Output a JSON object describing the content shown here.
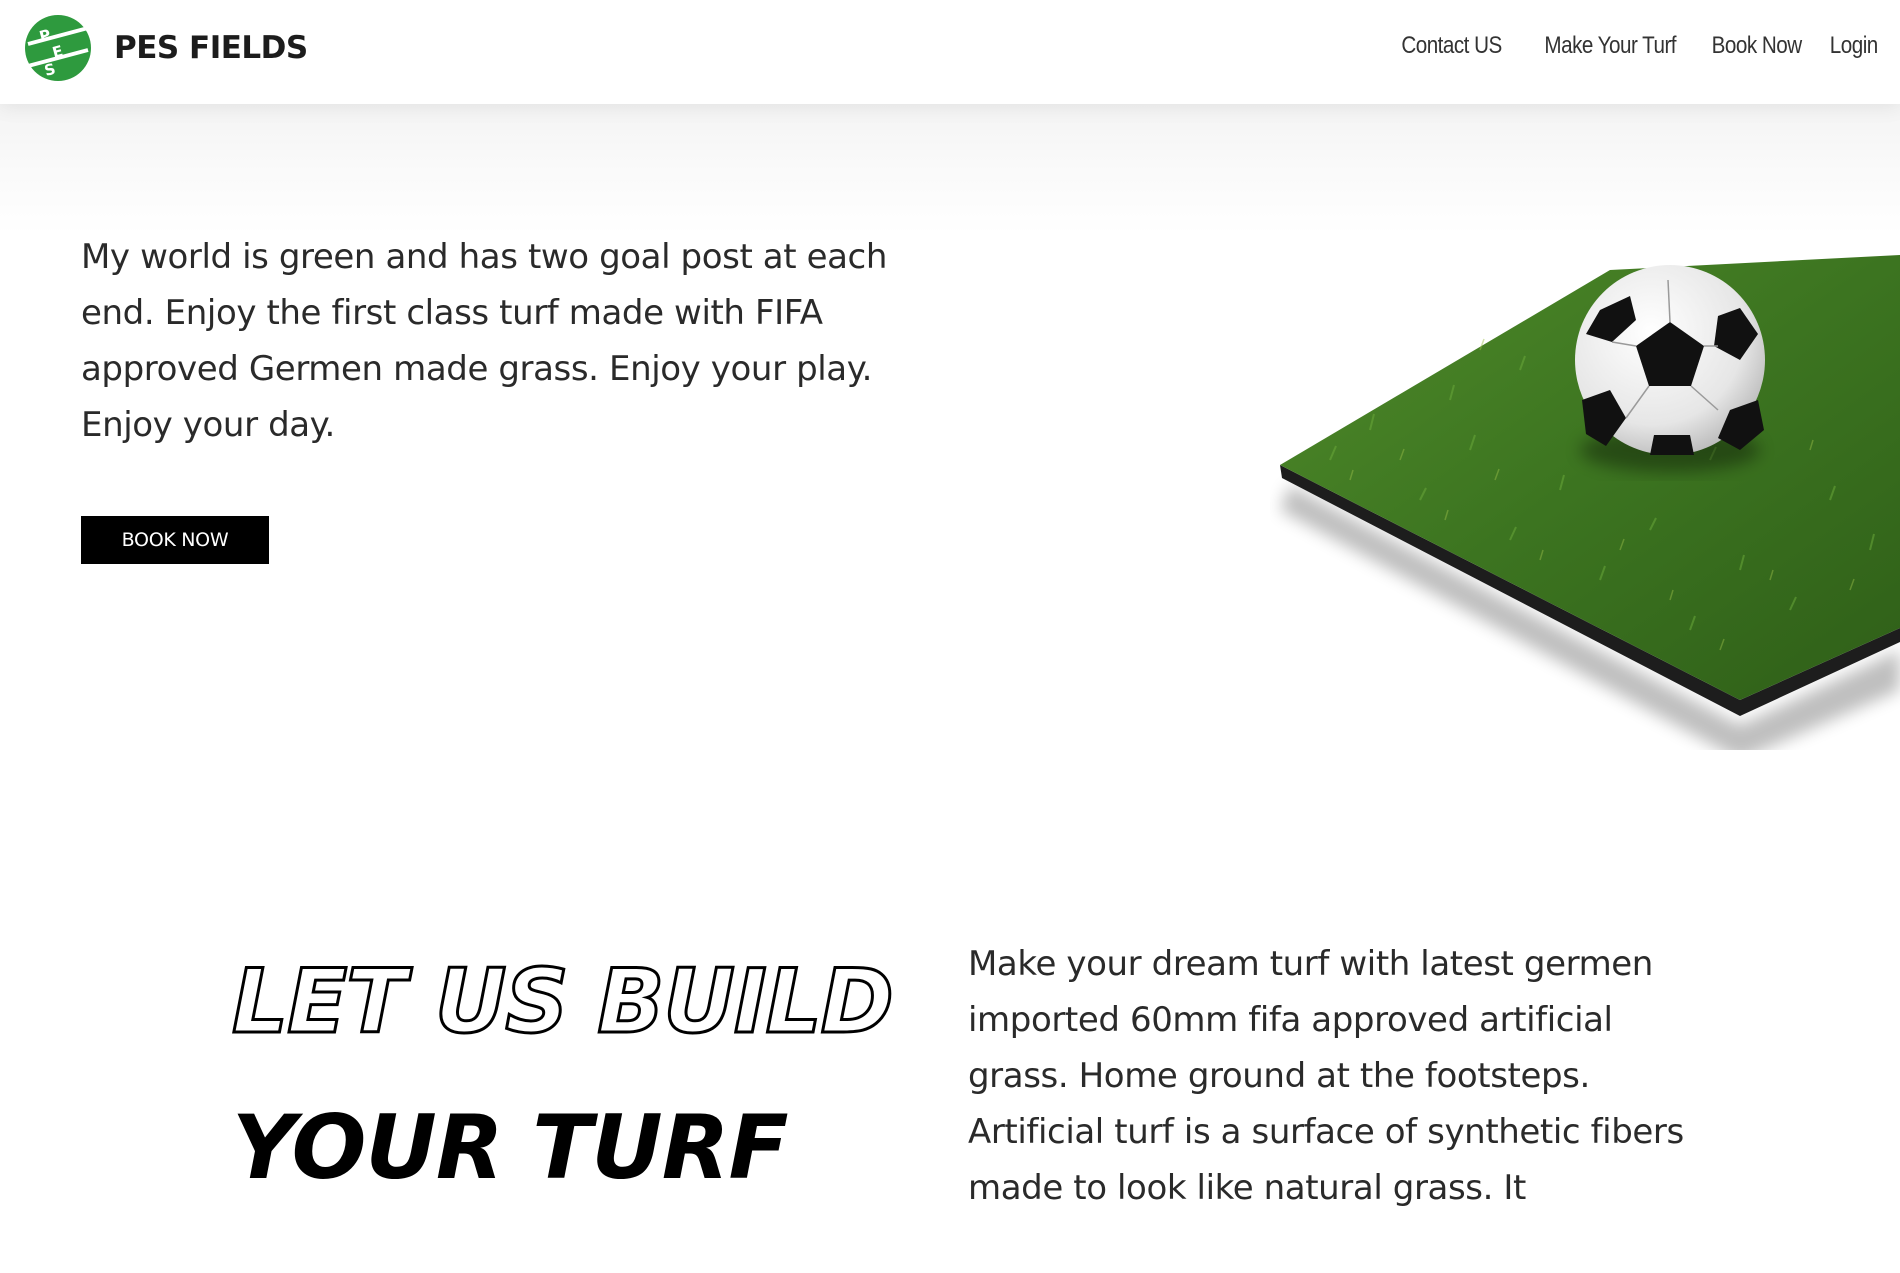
{
  "brand": {
    "name": "PES FIELDS",
    "logo_icon": "pes-fields-logo-icon",
    "logo_letters": [
      "P",
      "E",
      "S"
    ],
    "accent_color": "#2e9a3e"
  },
  "nav": {
    "items": [
      {
        "label": "Contact US"
      },
      {
        "label": "Make Your Turf"
      },
      {
        "label": "Book Now"
      },
      {
        "label": "Login"
      }
    ]
  },
  "hero": {
    "text": "My world is green and has two goal post at each end. Enjoy the first class turf made with FIFA approved Germen made grass. Enjoy your play. Enjoy your day.",
    "button_label": "BOOK NOW",
    "image_icon": "soccer-ball-on-turf-icon"
  },
  "build": {
    "title_outline": "LET US BUILD",
    "title_solid": "YOUR TURF",
    "paragraph_1": "Make your dream turf with latest germen imported 60mm fifa approved artificial grass. Home ground at the footsteps.",
    "paragraph_2": "Artificial turf is a surface of synthetic fibers made to look like natural grass. It"
  }
}
